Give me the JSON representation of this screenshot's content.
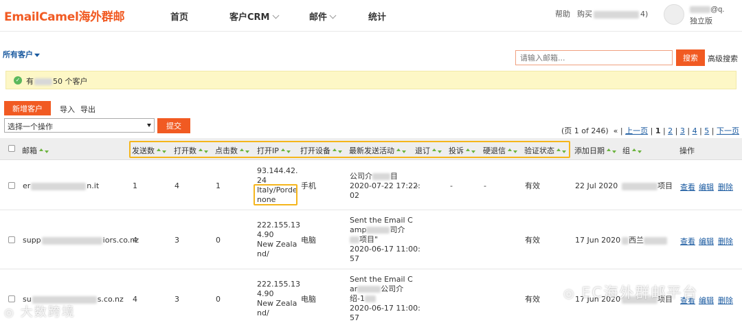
{
  "header": {
    "logo": "EmailCamel海外群邮",
    "nav": [
      {
        "label": "首页"
      },
      {
        "label": "客户CRM"
      },
      {
        "label": "邮件"
      },
      {
        "label": "统计"
      }
    ],
    "help": "帮助",
    "buy": "购买",
    "buy_suffix": "4)",
    "user_suffix": "@q.",
    "plan": "独立版"
  },
  "filter": {
    "all_customers": "所有客户",
    "search_placeholder": "请输入邮箱...",
    "search_button": "搜索",
    "advanced_search": "高级搜索"
  },
  "notice": {
    "prefix": "有",
    "suffix": "50 个客户"
  },
  "actions": {
    "add_customer": "新增客户",
    "import": "导入",
    "export": "导出",
    "select_value": "选择一个操作",
    "submit": "提交"
  },
  "pager": {
    "page_info": "(页 1 of 246)",
    "first": "«",
    "prev": "上一页",
    "pages": [
      "1",
      "2",
      "3",
      "4",
      "5"
    ],
    "next": "下一页",
    "last": "»"
  },
  "table": {
    "columns": [
      "邮箱",
      "发送数",
      "打开数",
      "点击数",
      "打开IP",
      "打开设备",
      "最新发送活动",
      "退订",
      "投诉",
      "硬退信",
      "验证状态",
      "添加日期",
      "组",
      "操作"
    ],
    "rows": [
      {
        "email_prefix": "er",
        "email_suffix": "n.it",
        "sent": "1",
        "opens": "4",
        "clicks": "1",
        "ip_lines": [
          "93.144.42.",
          "24",
          "Italy/Porde",
          "none"
        ],
        "device": "手机",
        "activity_lines": [
          "公司介",
          "",
          "2020-07-22 17:22:",
          "02"
        ],
        "activity_mid": "目",
        "unsub": "-",
        "complaint": "-",
        "hard_bounce": "-",
        "verify": "有效",
        "added": "22 Jul 2020",
        "group_suffix": "项目",
        "view": "查看",
        "edit": "编辑",
        "delete": "删除"
      },
      {
        "email_prefix": "supp",
        "email_suffix": "iors.co.nz",
        "sent": "4",
        "opens": "3",
        "clicks": "0",
        "ip_lines": [
          "222.155.13",
          "4.90",
          "New Zeala",
          "nd/"
        ],
        "device": "电脑",
        "activity_lines": [
          "Sent the Email C",
          "amp",
          "",
          "2020-06-17 11:00:",
          "57"
        ],
        "activity_mid1": "司介",
        "activity_mid2": "项目\"",
        "unsub": "",
        "complaint": "",
        "hard_bounce": "",
        "verify": "有效",
        "added": "17 Jun 2020",
        "group_suffix": "西兰",
        "view": "查看",
        "edit": "编辑",
        "delete": "删除"
      },
      {
        "email_prefix": "su",
        "email_suffix": "s.co.nz",
        "sent": "4",
        "opens": "3",
        "clicks": "0",
        "ip_lines": [
          "222.155.13",
          "4.90",
          "New Zeala",
          "nd/"
        ],
        "device": "电脑",
        "activity_lines": [
          "Sent the Email C",
          "ar",
          "绍-1",
          "2020-06-17 11:00:",
          "57"
        ],
        "activity_mid1": "公司介",
        "unsub": "",
        "complaint": "",
        "hard_bounce": "",
        "verify": "有效",
        "added": "17 Jun 2020",
        "group_suffix": "项目",
        "view": "查看",
        "edit": "编辑",
        "delete": "删除"
      }
    ]
  },
  "watermarks": {
    "left": "大数跨境",
    "right": "EC海外群邮平台"
  }
}
